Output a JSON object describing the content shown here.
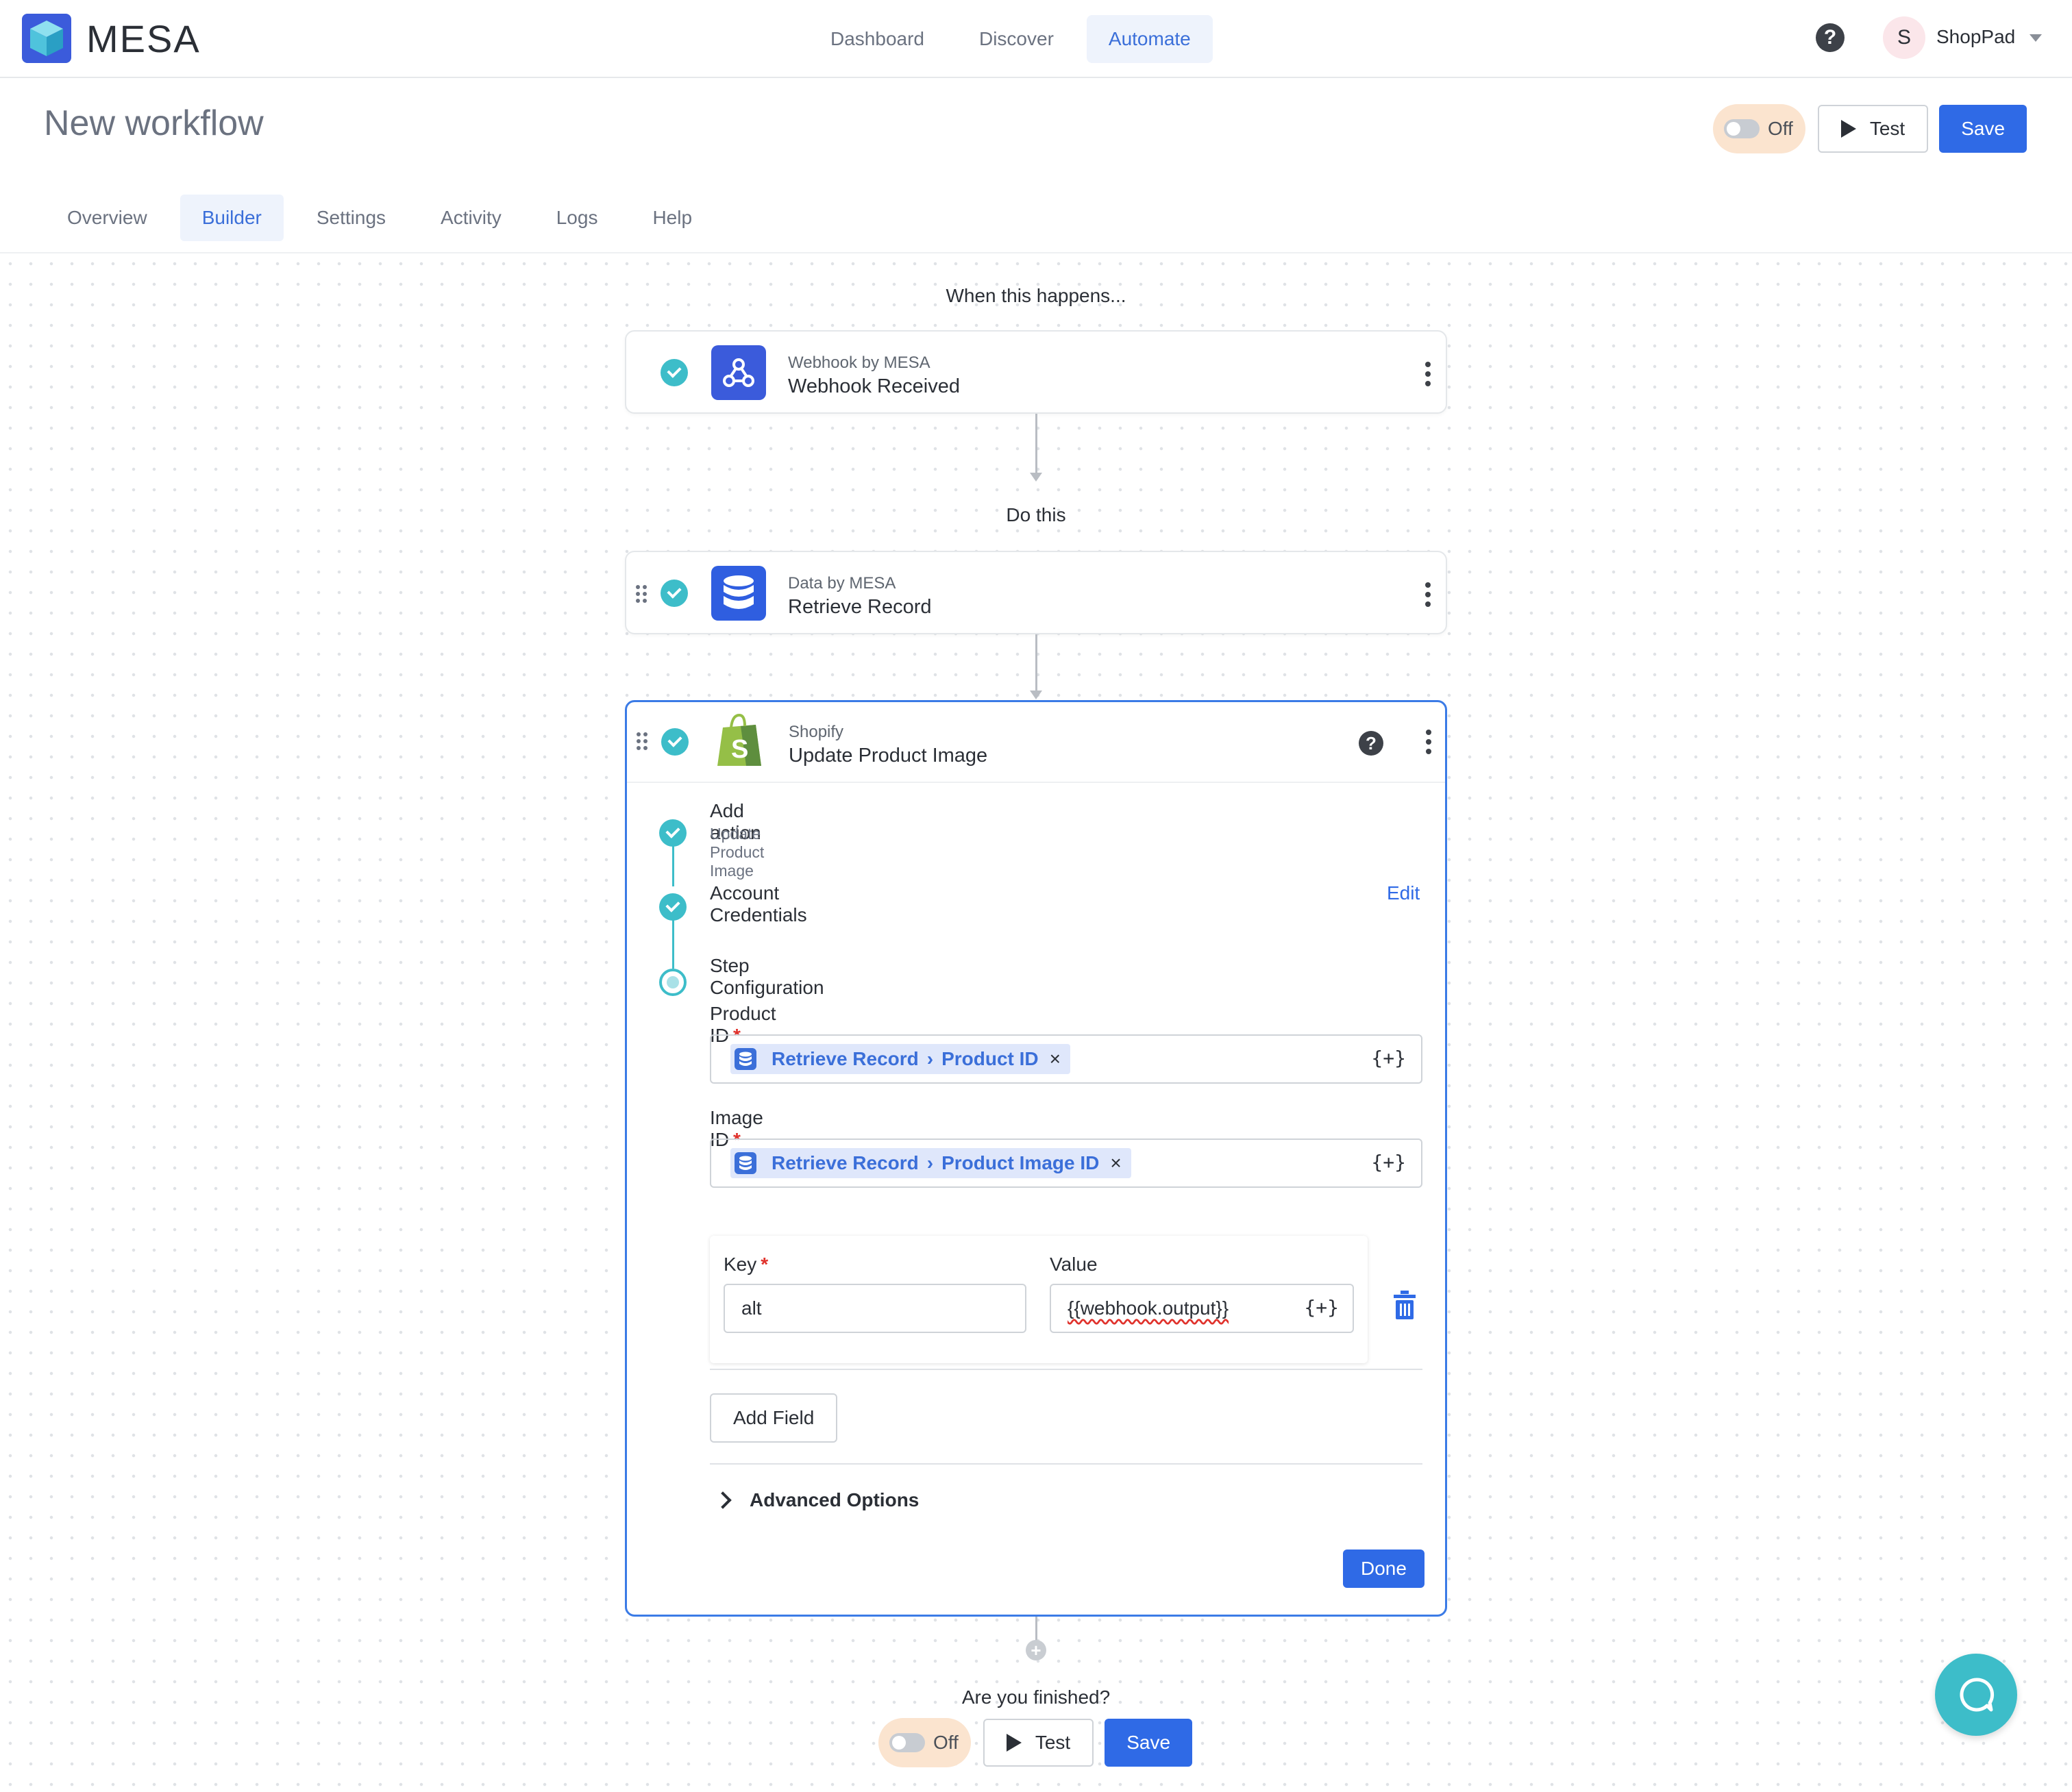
{
  "app": {
    "brand": "MESA",
    "accent": "#2f6ae6",
    "teal": "#3dbdc9"
  },
  "nav": {
    "items": [
      {
        "label": "Dashboard",
        "active": false
      },
      {
        "label": "Discover",
        "active": false
      },
      {
        "label": "Automate",
        "active": true
      }
    ],
    "help_icon": "question-circle-icon",
    "account": {
      "initial": "S",
      "name": "ShopPad"
    }
  },
  "header": {
    "title": "New workflow",
    "toggle_label": "Off",
    "test_label": "Test",
    "save_label": "Save"
  },
  "tabs": [
    {
      "label": "Overview",
      "active": false
    },
    {
      "label": "Builder",
      "active": true
    },
    {
      "label": "Settings",
      "active": false
    },
    {
      "label": "Activity",
      "active": false
    },
    {
      "label": "Logs",
      "active": false
    },
    {
      "label": "Help",
      "active": false
    }
  ],
  "workflow": {
    "trigger_caption": "When this happens...",
    "action_caption": "Do this",
    "trigger": {
      "app": "Webhook by MESA",
      "step": "Webhook Received",
      "icon": "webhook-icon"
    },
    "action1": {
      "app": "Data by MESA",
      "step": "Retrieve Record",
      "icon": "database-icon"
    },
    "action2": {
      "app": "Shopify",
      "step": "Update Product Image",
      "icon": "shopify-bag-icon",
      "stepper": {
        "add_action_title": "Add action",
        "add_action_sub": "Update Product Image",
        "credentials_title": "Account Credentials",
        "edit_label": "Edit",
        "config_title": "Step Configuration"
      },
      "fields": {
        "product_id": {
          "label": "Product ID",
          "chip_source": "Retrieve Record",
          "chip_field": "Product ID",
          "var_button": "{+}"
        },
        "image_id": {
          "label": "Image ID",
          "chip_source": "Retrieve Record",
          "chip_field": "Product Image ID",
          "var_button": "{+}"
        },
        "kv": {
          "key_label": "Key",
          "value_label": "Value",
          "key_value": "alt",
          "value_value": "{{webhook.output}}",
          "var_button": "{+}"
        }
      },
      "add_field_label": "Add Field",
      "advanced_label": "Advanced Options",
      "done_label": "Done"
    },
    "finish_caption": "Are you finished?",
    "footer": {
      "toggle_label": "Off",
      "test_label": "Test",
      "save_label": "Save"
    }
  }
}
